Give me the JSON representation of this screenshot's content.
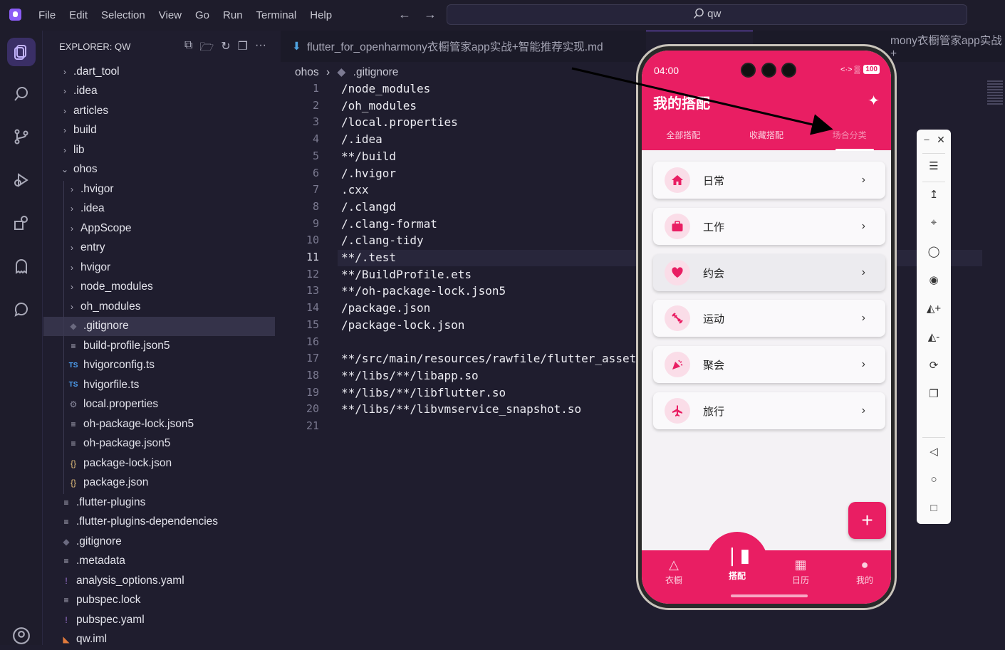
{
  "menu": [
    "File",
    "Edit",
    "Selection",
    "View",
    "Go",
    "Run",
    "Terminal",
    "Help"
  ],
  "search": {
    "text": "qw"
  },
  "explorer": {
    "title": "EXPLORER: QW",
    "items": [
      {
        "label": ".dart_tool",
        "type": "folder"
      },
      {
        "label": ".idea",
        "type": "folder"
      },
      {
        "label": "articles",
        "type": "folder"
      },
      {
        "label": "build",
        "type": "folder"
      },
      {
        "label": "lib",
        "type": "folder"
      },
      {
        "label": "ohos",
        "type": "folder-open"
      },
      {
        "label": ".hvigor",
        "type": "folder"
      },
      {
        "label": ".idea",
        "type": "folder"
      },
      {
        "label": "AppScope",
        "type": "folder"
      },
      {
        "label": "entry",
        "type": "folder"
      },
      {
        "label": "hvigor",
        "type": "folder"
      },
      {
        "label": "node_modules",
        "type": "folder"
      },
      {
        "label": "oh_modules",
        "type": "folder"
      },
      {
        "label": ".gitignore",
        "type": "git"
      },
      {
        "label": "build-profile.json5",
        "type": "lines"
      },
      {
        "label": "hvigorconfig.ts",
        "type": "ts"
      },
      {
        "label": "hvigorfile.ts",
        "type": "ts"
      },
      {
        "label": "local.properties",
        "type": "gear"
      },
      {
        "label": "oh-package-lock.json5",
        "type": "lines"
      },
      {
        "label": "oh-package.json5",
        "type": "lines"
      },
      {
        "label": "package-lock.json",
        "type": "json"
      },
      {
        "label": "package.json",
        "type": "json"
      },
      {
        "label": ".flutter-plugins",
        "type": "lines"
      },
      {
        "label": ".flutter-plugins-dependencies",
        "type": "lines"
      },
      {
        "label": ".gitignore",
        "type": "git"
      },
      {
        "label": ".metadata",
        "type": "lines"
      },
      {
        "label": "analysis_options.yaml",
        "type": "yaml"
      },
      {
        "label": "pubspec.lock",
        "type": "lines"
      },
      {
        "label": "pubspec.yaml",
        "type": "yaml"
      },
      {
        "label": "qw.iml",
        "type": "rss"
      }
    ]
  },
  "tabs": {
    "first": "flutter_for_openharmony衣橱管家app实战+智能推荐实现.md",
    "last": "mony衣橱管家app实战+"
  },
  "breadcrumb": {
    "folder": "ohos",
    "file": ".gitignore"
  },
  "code": {
    "current_line": 11,
    "lines": [
      "/node_modules",
      "/oh_modules",
      "/local.properties",
      "/.idea",
      "**/build",
      "/.hvigor",
      ".cxx",
      "/.clangd",
      "/.clang-format",
      "/.clang-tidy",
      "**/.test",
      "**/BuildProfile.ets",
      "**/oh-package-lock.json5",
      "/package.json",
      "/package-lock.json",
      "",
      "**/src/main/resources/rawfile/flutter_asset",
      "**/libs/**/libapp.so",
      "**/libs/**/libflutter.so",
      "**/libs/**/libvmservice_snapshot.so",
      ""
    ]
  },
  "phone": {
    "time": "04:00",
    "battery": "100",
    "title": "我的搭配",
    "top_tabs": [
      "全部搭配",
      "收藏搭配",
      "场合分类"
    ],
    "categories": [
      {
        "label": "日常",
        "icon": "home-icon"
      },
      {
        "label": "工作",
        "icon": "briefcase-icon"
      },
      {
        "label": "约会",
        "icon": "heart-icon"
      },
      {
        "label": "运动",
        "icon": "dumbbell-icon"
      },
      {
        "label": "聚会",
        "icon": "party-icon"
      },
      {
        "label": "旅行",
        "icon": "airplane-icon"
      }
    ],
    "fab": "+",
    "bottom_nav": [
      "衣橱",
      "搭配",
      "日历",
      "我的"
    ],
    "colors": {
      "primary": "#e91e63",
      "icon_bg": "#fadde8"
    }
  }
}
